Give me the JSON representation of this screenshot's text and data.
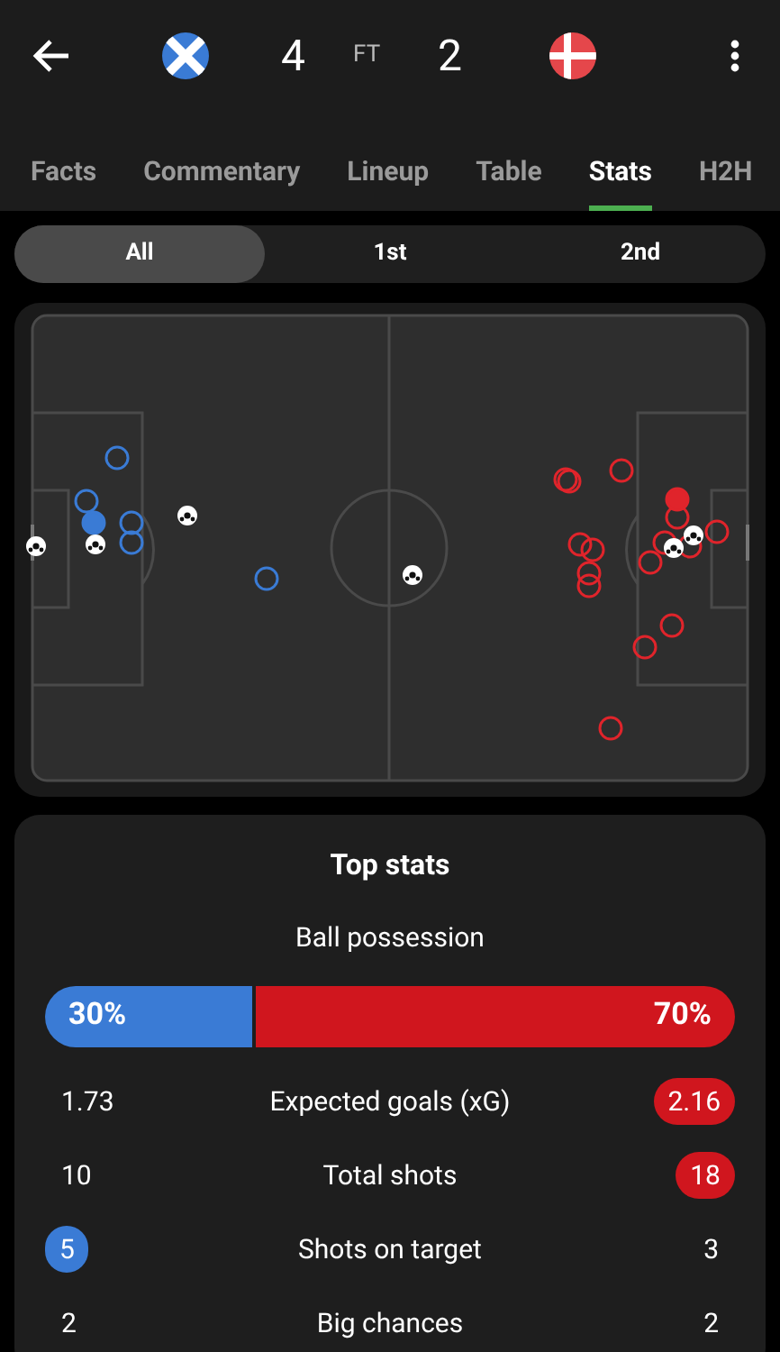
{
  "header": {
    "home_score": "4",
    "status": "FT",
    "away_score": "2"
  },
  "tabs": [
    {
      "label": "Facts",
      "selected": false
    },
    {
      "label": "Commentary",
      "selected": false
    },
    {
      "label": "Lineup",
      "selected": false
    },
    {
      "label": "Table",
      "selected": false
    },
    {
      "label": "Stats",
      "selected": true
    },
    {
      "label": "H2H",
      "selected": false
    }
  ],
  "periods": [
    {
      "label": "All",
      "selected": true
    },
    {
      "label": "1st",
      "selected": false
    },
    {
      "label": "2nd",
      "selected": false
    }
  ],
  "top_stats": {
    "title": "Top stats",
    "possession": {
      "label": "Ball possession",
      "home": "30%",
      "away": "70%",
      "level": 0.3
    },
    "rows": [
      {
        "home": "1.73",
        "label": "Expected goals (xG)",
        "away": "2.16",
        "home_highlighted": false,
        "away_highlighted": true
      },
      {
        "home": "10",
        "label": "Total shots",
        "away": "18",
        "home_highlighted": false,
        "away_highlighted": true
      },
      {
        "home": "5",
        "label": "Shots on target",
        "away": "3",
        "home_highlighted": true,
        "away_highlighted": false
      },
      {
        "home": "2",
        "label": "Big chances",
        "away": "2",
        "home_highlighted": false,
        "away_highlighted": false
      }
    ]
  }
}
